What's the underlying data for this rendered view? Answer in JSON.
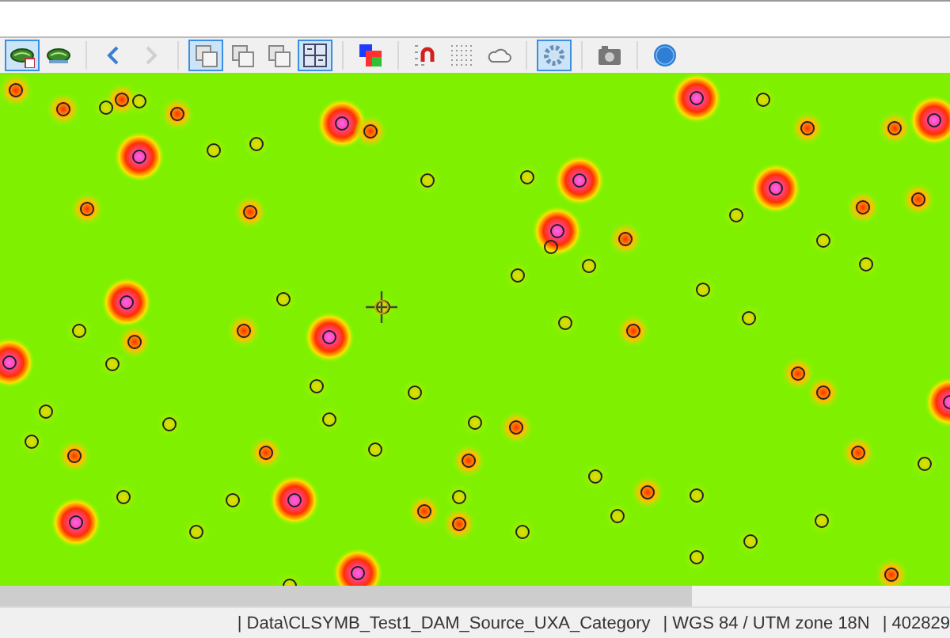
{
  "toolbar": {
    "buttons": [
      {
        "kind": "layer-red",
        "on": true,
        "disabled": false
      },
      {
        "kind": "layer",
        "on": false,
        "disabled": false
      },
      {
        "kind": "back",
        "on": false,
        "disabled": false
      },
      {
        "kind": "forward",
        "on": false,
        "disabled": true
      },
      {
        "kind": "overlay",
        "on": true,
        "disabled": false
      },
      {
        "kind": "overlay",
        "on": false,
        "disabled": false
      },
      {
        "kind": "overlay",
        "on": false,
        "disabled": false
      },
      {
        "kind": "overlay-grid",
        "on": true,
        "disabled": false
      },
      {
        "kind": "colors",
        "on": false,
        "disabled": false
      },
      {
        "kind": "magnet",
        "on": false,
        "disabled": false
      },
      {
        "kind": "grid",
        "on": false,
        "disabled": false
      },
      {
        "kind": "cloud",
        "on": false,
        "disabled": false
      },
      {
        "kind": "gear",
        "on": true,
        "disabled": false
      },
      {
        "kind": "camera",
        "on": false,
        "disabled": false
      },
      {
        "kind": "help",
        "on": false,
        "disabled": false
      }
    ]
  },
  "status_bar": {
    "fields": [
      "| Data\\CLSYMB_Test1_DAM_Source_UXA_Category",
      "| WGS 84 / UTM zone 18N",
      "| 402829"
    ]
  }
}
